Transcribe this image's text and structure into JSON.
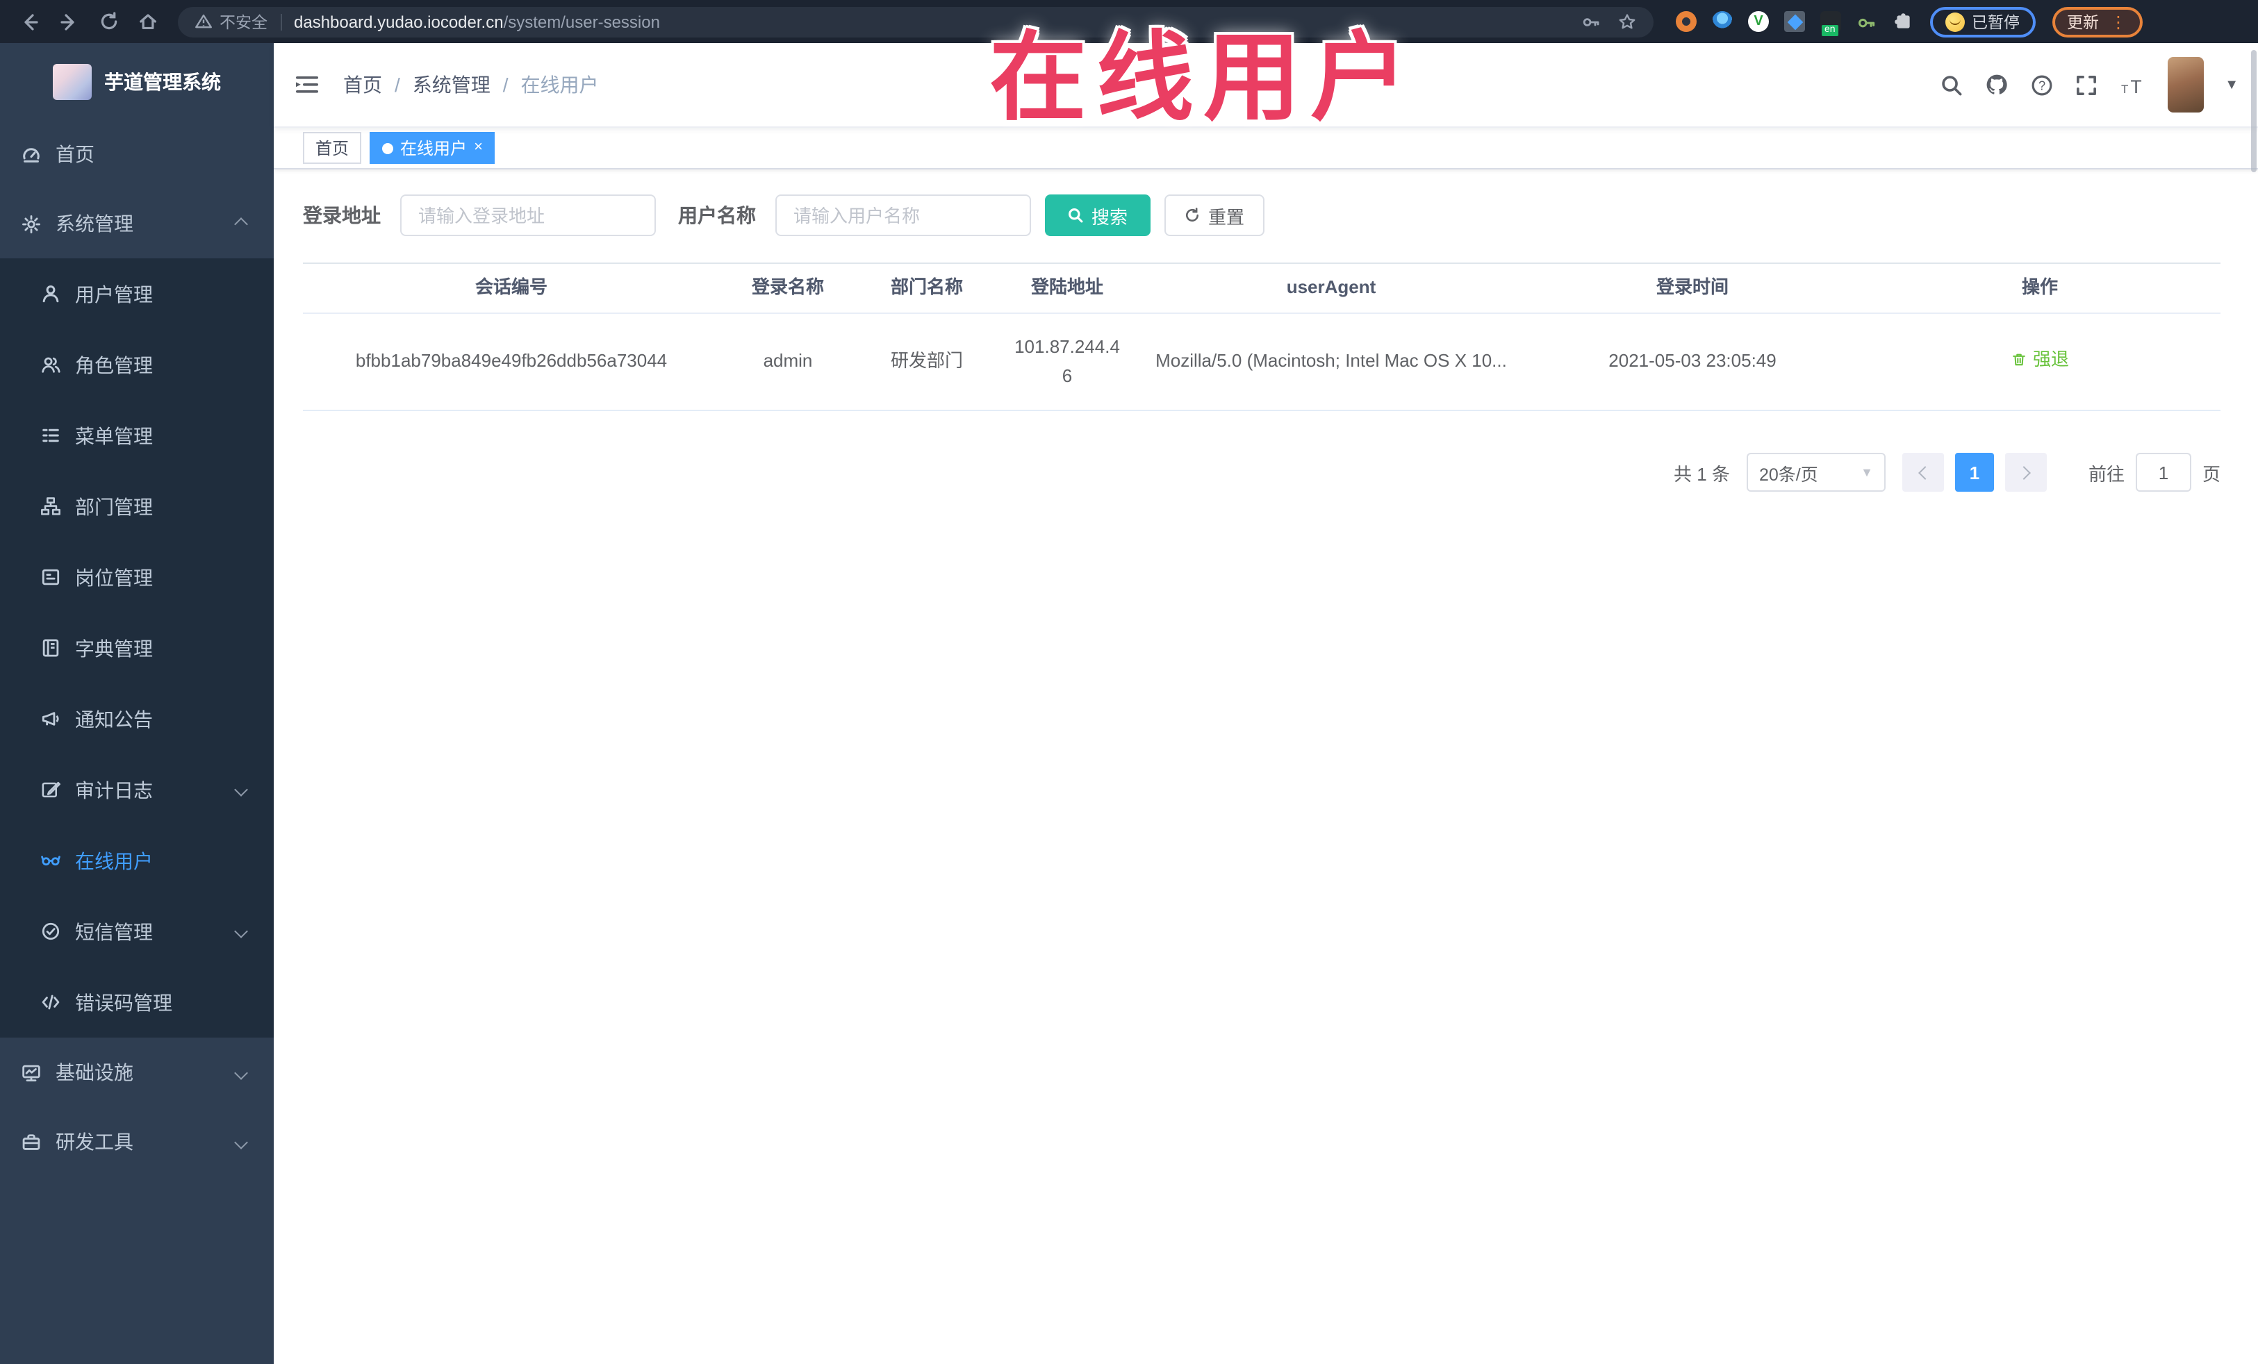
{
  "browser": {
    "security_label": "不安全",
    "url_host": "dashboard.yudao.iocoder.cn",
    "url_path": "/system/user-session",
    "extension_en_badge": "en",
    "profile_status_label": "已暂停",
    "update_label": "更新",
    "kebab_glyph": "⋮"
  },
  "overlay": {
    "title": "在线用户",
    "color": "#ea3e62"
  },
  "sidebar": {
    "logo_title": "芋道管理系统",
    "top_items": [
      {
        "label": "首页",
        "icon": "dashboard-icon"
      },
      {
        "label": "系统管理",
        "icon": "gear-icon",
        "expanded": true
      }
    ],
    "submenu_items": [
      {
        "label": "用户管理",
        "icon": "user-icon"
      },
      {
        "label": "角色管理",
        "icon": "users-icon"
      },
      {
        "label": "菜单管理",
        "icon": "menu-list-icon"
      },
      {
        "label": "部门管理",
        "icon": "org-tree-icon"
      },
      {
        "label": "岗位管理",
        "icon": "badge-icon"
      },
      {
        "label": "字典管理",
        "icon": "book-icon"
      },
      {
        "label": "通知公告",
        "icon": "megaphone-icon"
      },
      {
        "label": "审计日志",
        "icon": "edit-log-icon",
        "collapsible": true
      },
      {
        "label": "在线用户",
        "icon": "online-users-icon",
        "active": true
      },
      {
        "label": "短信管理",
        "icon": "sms-check-icon",
        "collapsible": true
      },
      {
        "label": "错误码管理",
        "icon": "code-icon"
      }
    ],
    "bottom_items": [
      {
        "label": "基础设施",
        "icon": "infrastructure-icon",
        "collapsible": true
      },
      {
        "label": "研发工具",
        "icon": "toolbox-icon",
        "collapsible": true
      }
    ]
  },
  "navbar": {
    "breadcrumb": [
      "首页",
      "系统管理",
      "在线用户"
    ],
    "separator": "/"
  },
  "tabs": [
    {
      "label": "首页"
    },
    {
      "label": "在线用户",
      "active": true,
      "close_glyph": "×"
    }
  ],
  "filters": {
    "login_address_label": "登录地址",
    "login_address_placeholder": "请输入登录地址",
    "username_label": "用户名称",
    "username_placeholder": "请输入用户名称",
    "search_label": "搜索",
    "reset_label": "重置"
  },
  "table": {
    "columns": [
      "会话编号",
      "登录名称",
      "部门名称",
      "登陆地址",
      "userAgent",
      "登录时间",
      "操作"
    ],
    "rows": [
      {
        "session_id": "bfbb1ab79ba849e49fb26ddb56a73044",
        "username": "admin",
        "department": "研发部门",
        "login_ip": "101.87.244.46",
        "user_agent": "Mozilla/5.0 (Macintosh; Intel Mac OS X 10...",
        "login_time": "2021-05-03 23:05:49",
        "action_label": "强退"
      }
    ]
  },
  "pagination": {
    "total_text": "共 1 条",
    "page_size_value": "20条/页",
    "current_page": "1",
    "goto_label": "前往",
    "goto_value": "1",
    "goto_suffix": "页"
  },
  "colors": {
    "accent": "#409eff",
    "search_button": "#26bfa6",
    "action_green": "#67c23a",
    "overlay_red": "#ea3e62",
    "sidebar_bg": "#2f3e52",
    "submenu_bg": "#1f2d3d",
    "chrome_bg": "#1c2431"
  }
}
